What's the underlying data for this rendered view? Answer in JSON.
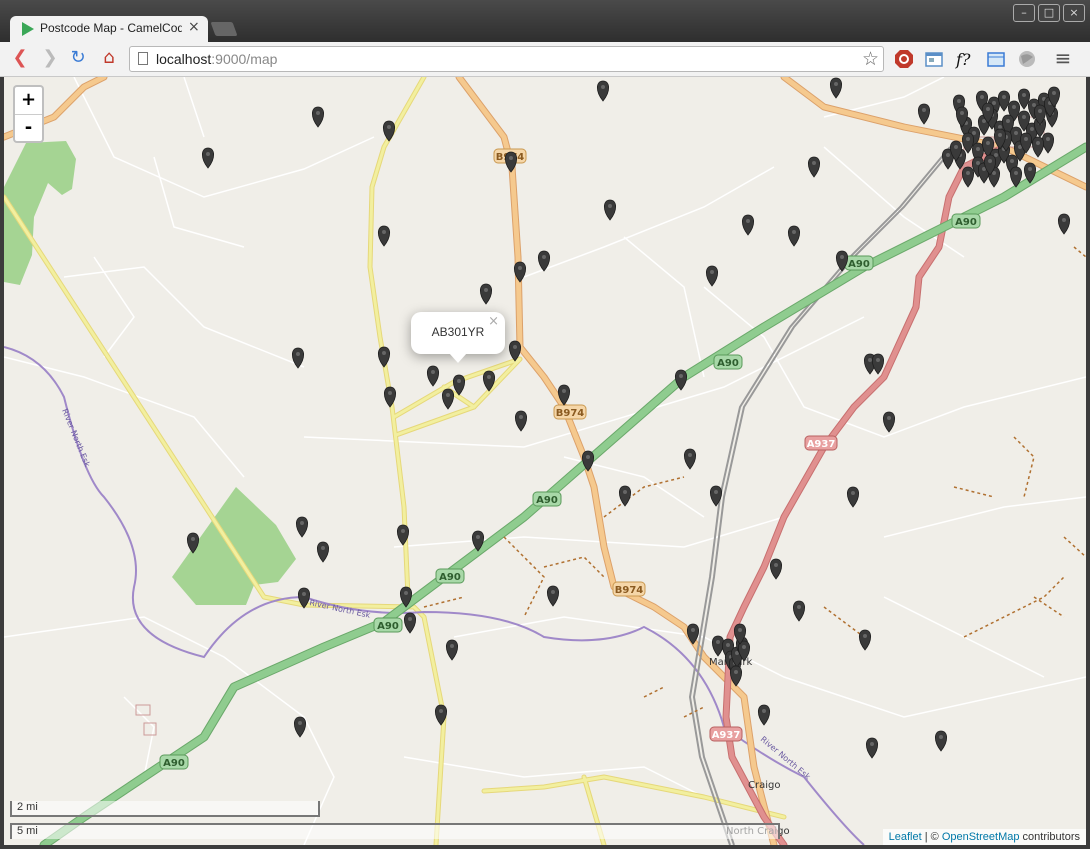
{
  "browser": {
    "tab_title": "Postcode Map - CamelCod",
    "tab_close": "×",
    "url_host": "localhost",
    "url_rest": ":9000/map",
    "window_controls": [
      "–",
      "□",
      "×"
    ],
    "extensions": [
      "adblock-icon",
      "window-icon",
      "f-question-icon",
      "folder-icon",
      "globe-icon"
    ]
  },
  "map": {
    "zoom_in": "+",
    "zoom_out": "-",
    "popup": {
      "text": "AB301YR",
      "close": "×"
    },
    "scale": {
      "top": "2 mi",
      "bottom": "5 mi"
    },
    "attribution": {
      "leaflet": "Leaflet",
      "sep": " | © ",
      "osm": "OpenStreetMap",
      "suffix": " contributors"
    },
    "road_labels": [
      "A90",
      "A90",
      "A90",
      "A90",
      "A90",
      "A90",
      "A90",
      "B974",
      "B974",
      "B974",
      "A937",
      "A937"
    ],
    "place_labels": [
      "Marykirk",
      "Craigo",
      "North Craigo"
    ],
    "river_labels": [
      "River North Esk",
      "River North Esk",
      "River North Esk"
    ],
    "marker_count": 111,
    "colors": {
      "land": "#f0eee8",
      "motorway": "#8fcc8f",
      "primary": "#e0908f",
      "secondary": "#f5c98e",
      "tertiary": "#f2ef9f",
      "river": "#a089c9",
      "wood": "#a5d493",
      "marker": "#3a3a3a"
    }
  }
}
